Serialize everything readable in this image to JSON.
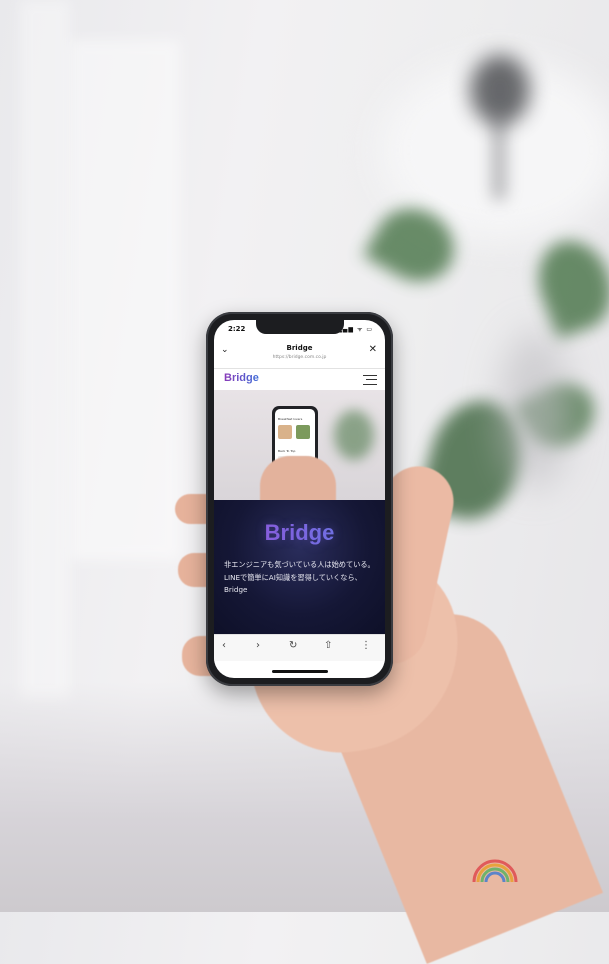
{
  "status": {
    "time": "2:22",
    "icons": "▂▄▆ ᯤ ▭"
  },
  "browser": {
    "title": "Bridge",
    "url": "https://bridge.com.co.jp",
    "back_icon": "chevron-down-icon",
    "close_glyph": "✕",
    "chevron_glyph": "⌄"
  },
  "site": {
    "logo": "Bridge",
    "hero_mini": {
      "heading1": "Breakfast lovers",
      "heading2": "Back To Top"
    }
  },
  "dark_section": {
    "brand": "Bridge",
    "line1": "非エンジニアも気づいている人は始めている。",
    "line2": "LINEで簡単にAI知識を習得していくなら、",
    "line3": "Bridge"
  },
  "toolbar": {
    "back": "‹",
    "forward": "›",
    "reload": "↻",
    "share": "⇧",
    "more": "⋮"
  },
  "colors": {
    "brand_purple": "#8a3ab9",
    "brand_blue": "#3f6ed8",
    "dark_bg": "#151736"
  }
}
